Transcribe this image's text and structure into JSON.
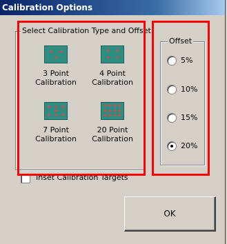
{
  "window": {
    "title": "Calibration Options"
  },
  "calibration_group": {
    "label": "Select Calibration Type and Offset",
    "items": [
      {
        "label_line1": "3 Point",
        "label_line2": "Calibration",
        "icon": "three-point-calibration-icon"
      },
      {
        "label_line1": "4 Point",
        "label_line2": "Calibration",
        "icon": "four-point-calibration-icon"
      },
      {
        "label_line1": "7 Point",
        "label_line2": "Calibration",
        "icon": "seven-point-calibration-icon"
      },
      {
        "label_line1": "20 Point",
        "label_line2": "Calibration",
        "icon": "twenty-point-calibration-icon"
      }
    ]
  },
  "offset_group": {
    "label": "Offset",
    "options": [
      "5%",
      "10%",
      "15%",
      "20%"
    ],
    "selected": "20%"
  },
  "inset_checkbox": {
    "label": "Inset Calibration Targets",
    "checked": false
  },
  "ok_button": {
    "label": "OK"
  },
  "colors": {
    "icon_bg": "#2f8c80",
    "target_marker": "#ff3a3a",
    "highlight": "#ff0000",
    "title_bar": "#0a246a"
  }
}
